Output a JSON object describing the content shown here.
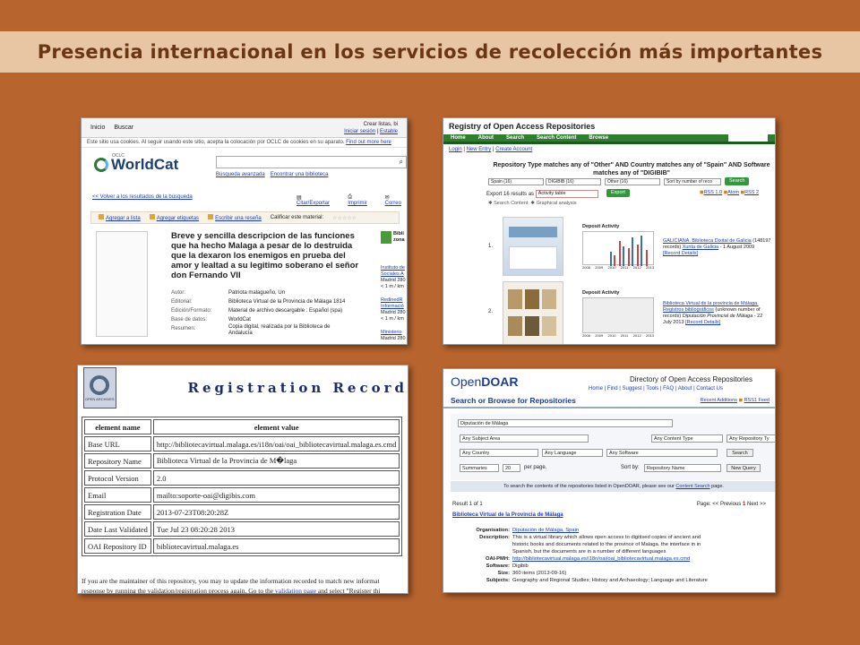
{
  "slide": {
    "title": "Presencia internacional en los servicios de recolección más importantes"
  },
  "worldcat": {
    "nav": [
      "Inicio",
      "Buscar"
    ],
    "top_right": [
      "Crear listas, bi",
      "Iniciar sesión",
      "Estable"
    ],
    "cookie": "Este sitio usa cookies. Al seguir usando este sitio, acepta la colocación por OCLC de cookies en su aparato.",
    "cookie_link": "Find out more here",
    "logo_small": "OCLC",
    "logo": "WorldCat",
    "search_links": [
      "Búsqueda avanzada",
      "Encontrar una biblioteca"
    ],
    "back_link": "<< Volver a los resultados de la búsqueda",
    "tools": [
      "Citar/Exportar",
      "Imprimir",
      "Correo"
    ],
    "actions": [
      "Agregar a lista",
      "Agregar etiquetas",
      "Escribir una reseña",
      "Calificar este material:"
    ],
    "rating": "☆☆☆☆☆",
    "book_title": "Breve y sencilla descripcion de las funciones que ha hecho Malaga a pesar de lo destruida que la dexaron los enemigos en prueba del amor y lealtad a su legitimo soberano el señor don Fernando VII",
    "meta": [
      {
        "label": "Autor:",
        "value": "Patriota malagueño, Un"
      },
      {
        "label": "Editorial:",
        "value": "Biblioteca Virtual de la Provincia de Málaga 1814"
      },
      {
        "label": "Edición/Formato:",
        "value": "Material de archivo descargable : Español (spa)"
      },
      {
        "label": "Base de datos:",
        "value": "WorldCat"
      },
      {
        "label": "Resumen:",
        "value": "Copia digital, realizada por la Biblioteca de Andalucía"
      }
    ],
    "side_header": [
      "Bibli",
      "zona"
    ],
    "side": [
      {
        "link": "Instituto de Sociales A",
        "text": "Madrid 280\n< 1 m / km"
      },
      {
        "link": "RedinedR Informació",
        "text": "Madrid 280\n< 1 m / km"
      },
      {
        "link": "Ministerio",
        "text": "Madrid 280"
      }
    ]
  },
  "roar": {
    "title": "Registry of Open Access Repositories",
    "nav": [
      "Home",
      "About",
      "Search",
      "Search Content",
      "Browse"
    ],
    "login": [
      "Login",
      "New Entry",
      "Create Account"
    ],
    "heading": "Repository Type matches any of \"Other\" AND Country matches any of \"Spain\" AND Software matches any of \"DIGIBIB\"",
    "filters": [
      "Spain (16)",
      "DIGIBIB (16)",
      "Other (16)",
      "Sort by number of reco"
    ],
    "search_btn": "Search",
    "export_label": "Export 16 results as",
    "export_select": "Activity table",
    "export_btn": "Export",
    "feeds": [
      "RSS 1.0",
      "Atom",
      "RSS 2"
    ],
    "links": [
      "Search Content",
      "Graphical analysis"
    ],
    "chart_title": "Deposit Activity",
    "chart_years": [
      "2008",
      "2009",
      "2010",
      "2011",
      "2012",
      "2013"
    ],
    "chart_yticks": [
      "100000",
      "10000",
      "1000",
      "100",
      "10",
      "1"
    ],
    "results": [
      {
        "num": "1.",
        "link": "GALICIANA. Biblioteca Dixital de Galicia",
        "count": "(148197 records)",
        "link2": "Xunta de Galicia",
        "date": "- 1 August 2009",
        "details": "[Record Details]"
      },
      {
        "num": "2.",
        "link": "Biblioteca Virtual de la provincia de Málaga. Registros bibliográficos",
        "count": "(unknown number of records)",
        "link2": "Diputación Provincial de Málaga",
        "date": "- 22 July 2013",
        "details": "[Record Details]"
      }
    ]
  },
  "oai": {
    "logo_caption": "OPEN ARCHIVES",
    "title": "Registration Record",
    "head_name": "element name",
    "head_value": "element value",
    "rows": [
      {
        "name": "Base URL",
        "value": "http://bibliotecavirtual.malaga.es/i18n/oai/oai_bibliotecavirtual.malaga.es.cmd"
      },
      {
        "name": "Repository Name",
        "value": "Biblioteca Virtual de la Provincia de M�laga"
      },
      {
        "name": "Protocol Version",
        "value": "2.0"
      },
      {
        "name": "Email",
        "value": "mailto:soporte-oai@digibis.com"
      },
      {
        "name": "Registration Date",
        "value": "2013-07-23T08:20:28Z"
      },
      {
        "name": "Date Last Validated",
        "value": "Tue Jul 23 08:20:28 2013"
      },
      {
        "name": "OAI Repository ID",
        "value": "bibliotecavirtual.malaga.es"
      }
    ],
    "footer1": "If you are the maintainer of this repository, you may to update the information recorded to match new informat",
    "footer2a": "response by running the validation/registration process again. Go to the",
    "footer_link": "validation page",
    "footer2b": "and select \"Register thi"
  },
  "opendoar": {
    "logo_a": "Open",
    "logo_b": "DOAR",
    "heading": "Directory of Open Access Repositories",
    "menu": "Home | Find | Suggest | Tools | FAQ | About | Contact Us",
    "search_title": "Search or Browse for Repositories",
    "recent": "Recent Additions",
    "rss": "RSS1 Feed",
    "query": "Diputación de Málaga",
    "selects_row1": [
      "Any Subject Area",
      "Any Content Type",
      "Any Repository Ty"
    ],
    "selects_row2": [
      "Any Country",
      "Any Language",
      "Any Software"
    ],
    "search_btn": "Search",
    "summaries": "Summaries",
    "per_page_n": "20",
    "per_page": "per page.",
    "sort_label": "Sort by:",
    "sort_value": "Repository Name",
    "new_query": "New Query",
    "note": "To search the contents of the repositories listed in OpenDOAR, please see our",
    "note_link": "Content Search",
    "note_end": "page.",
    "result_count": "Result 1 of 1",
    "page_label": "Page:",
    "prev": "<< Previous",
    "page_num": "1",
    "next": "Next >>",
    "result_title": "Biblioteca Virtual de la Provincia de Málaga",
    "details": [
      {
        "label": "Organisation:",
        "value": "Diputación de Málaga, Spain"
      },
      {
        "label": "Description:",
        "value": "This is a virtual library which allows open access to digitised copies of ancient and historic books and documents related to the province of Malaga. the interface in in Spanish, but the documents are in a number of different languages"
      },
      {
        "label": "OAI-PMH:",
        "value": "http://bibliotecavirtual.malaga.es/i18n/oai/oai_bibliotecavirtual.malaga.es.cmd"
      },
      {
        "label": "Software:",
        "value": "Digibib"
      },
      {
        "label": "Size:",
        "value": "360 items (2013-09-16)"
      },
      {
        "label": "Subjects:",
        "value": "Geography and Regional Studies; History and Archaeology; Language and Literature"
      }
    ]
  }
}
